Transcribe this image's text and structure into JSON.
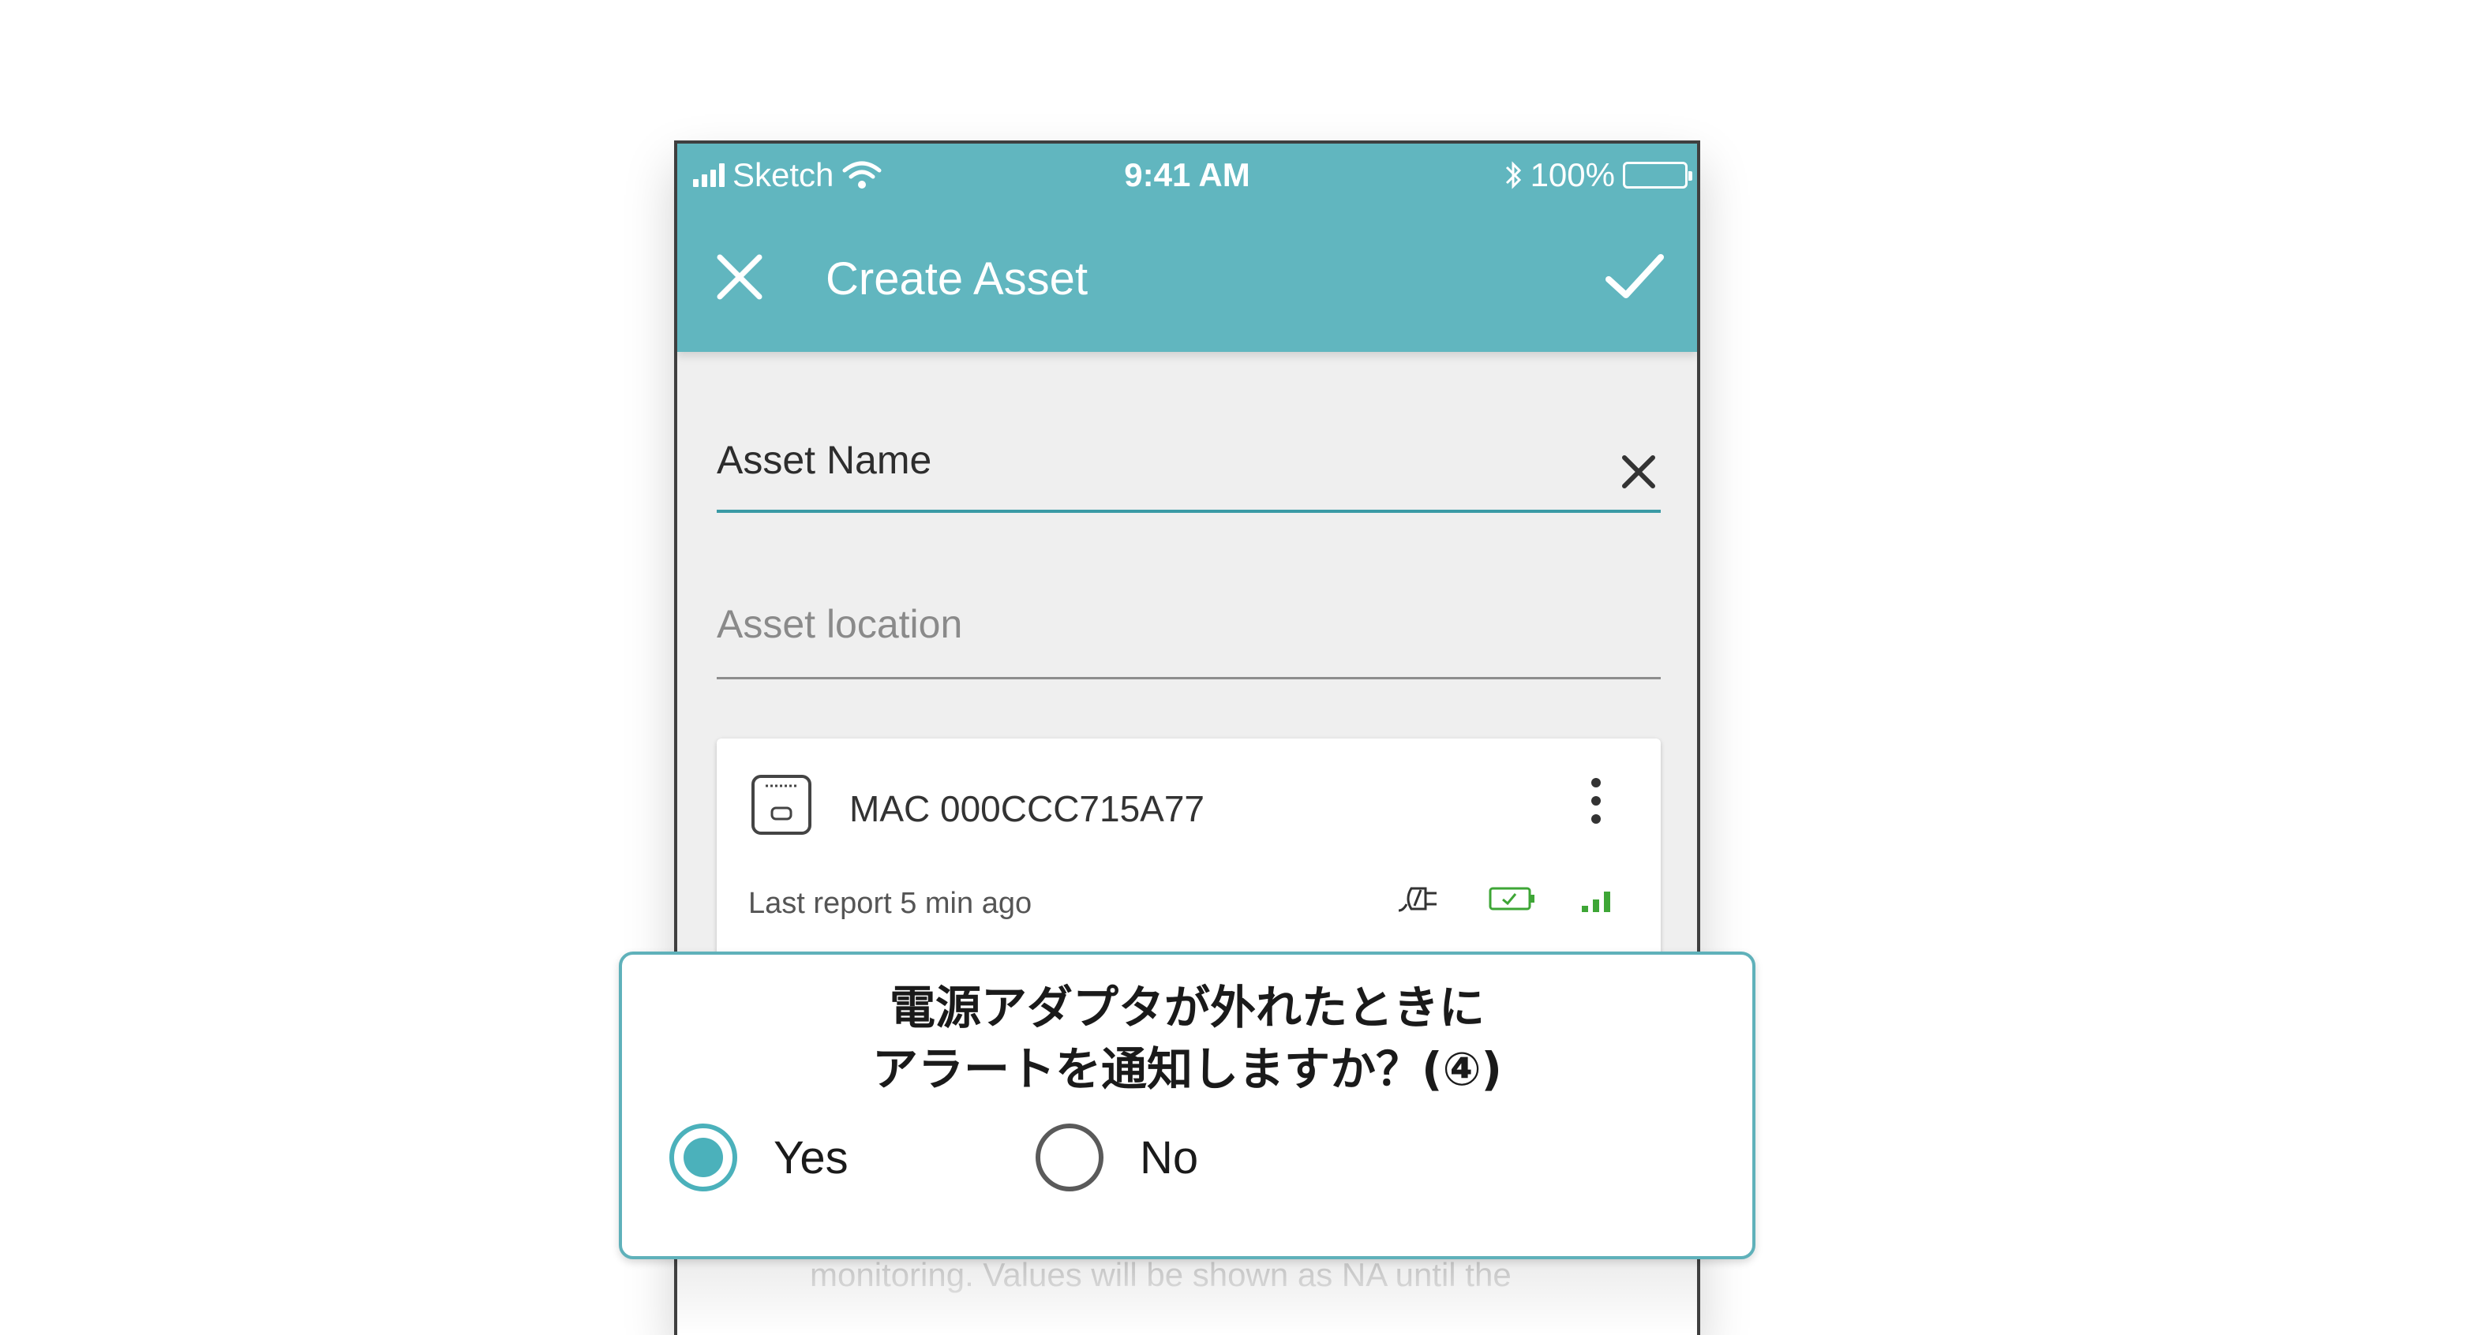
{
  "status_bar": {
    "carrier": "Sketch",
    "time": "9:41 AM",
    "battery": "100%"
  },
  "toolbar": {
    "title": "Create Asset",
    "close_icon": "close-icon",
    "confirm_icon": "check-icon"
  },
  "form": {
    "asset_name": {
      "value": "Asset Name"
    },
    "asset_location": {
      "placeholder": "Asset location"
    }
  },
  "device_card": {
    "mac": "MAC 000CCC715A77",
    "last_report": "Last report 5 min ago",
    "icons": [
      "plug-icon",
      "battery-icon",
      "signal-icon"
    ]
  },
  "faded_text": "monitoring. Values will be shown as NA until the",
  "overlay": {
    "question_line1": "電源アダプタが外れたときに",
    "question_line2": "アラートを通知しますか？(④)",
    "options": [
      {
        "label": "Yes",
        "selected": true
      },
      {
        "label": "No",
        "selected": false
      }
    ]
  },
  "colors": {
    "accent": "#61b6bf",
    "radio_selected": "#4bb1bb",
    "good": "#3ea636"
  }
}
